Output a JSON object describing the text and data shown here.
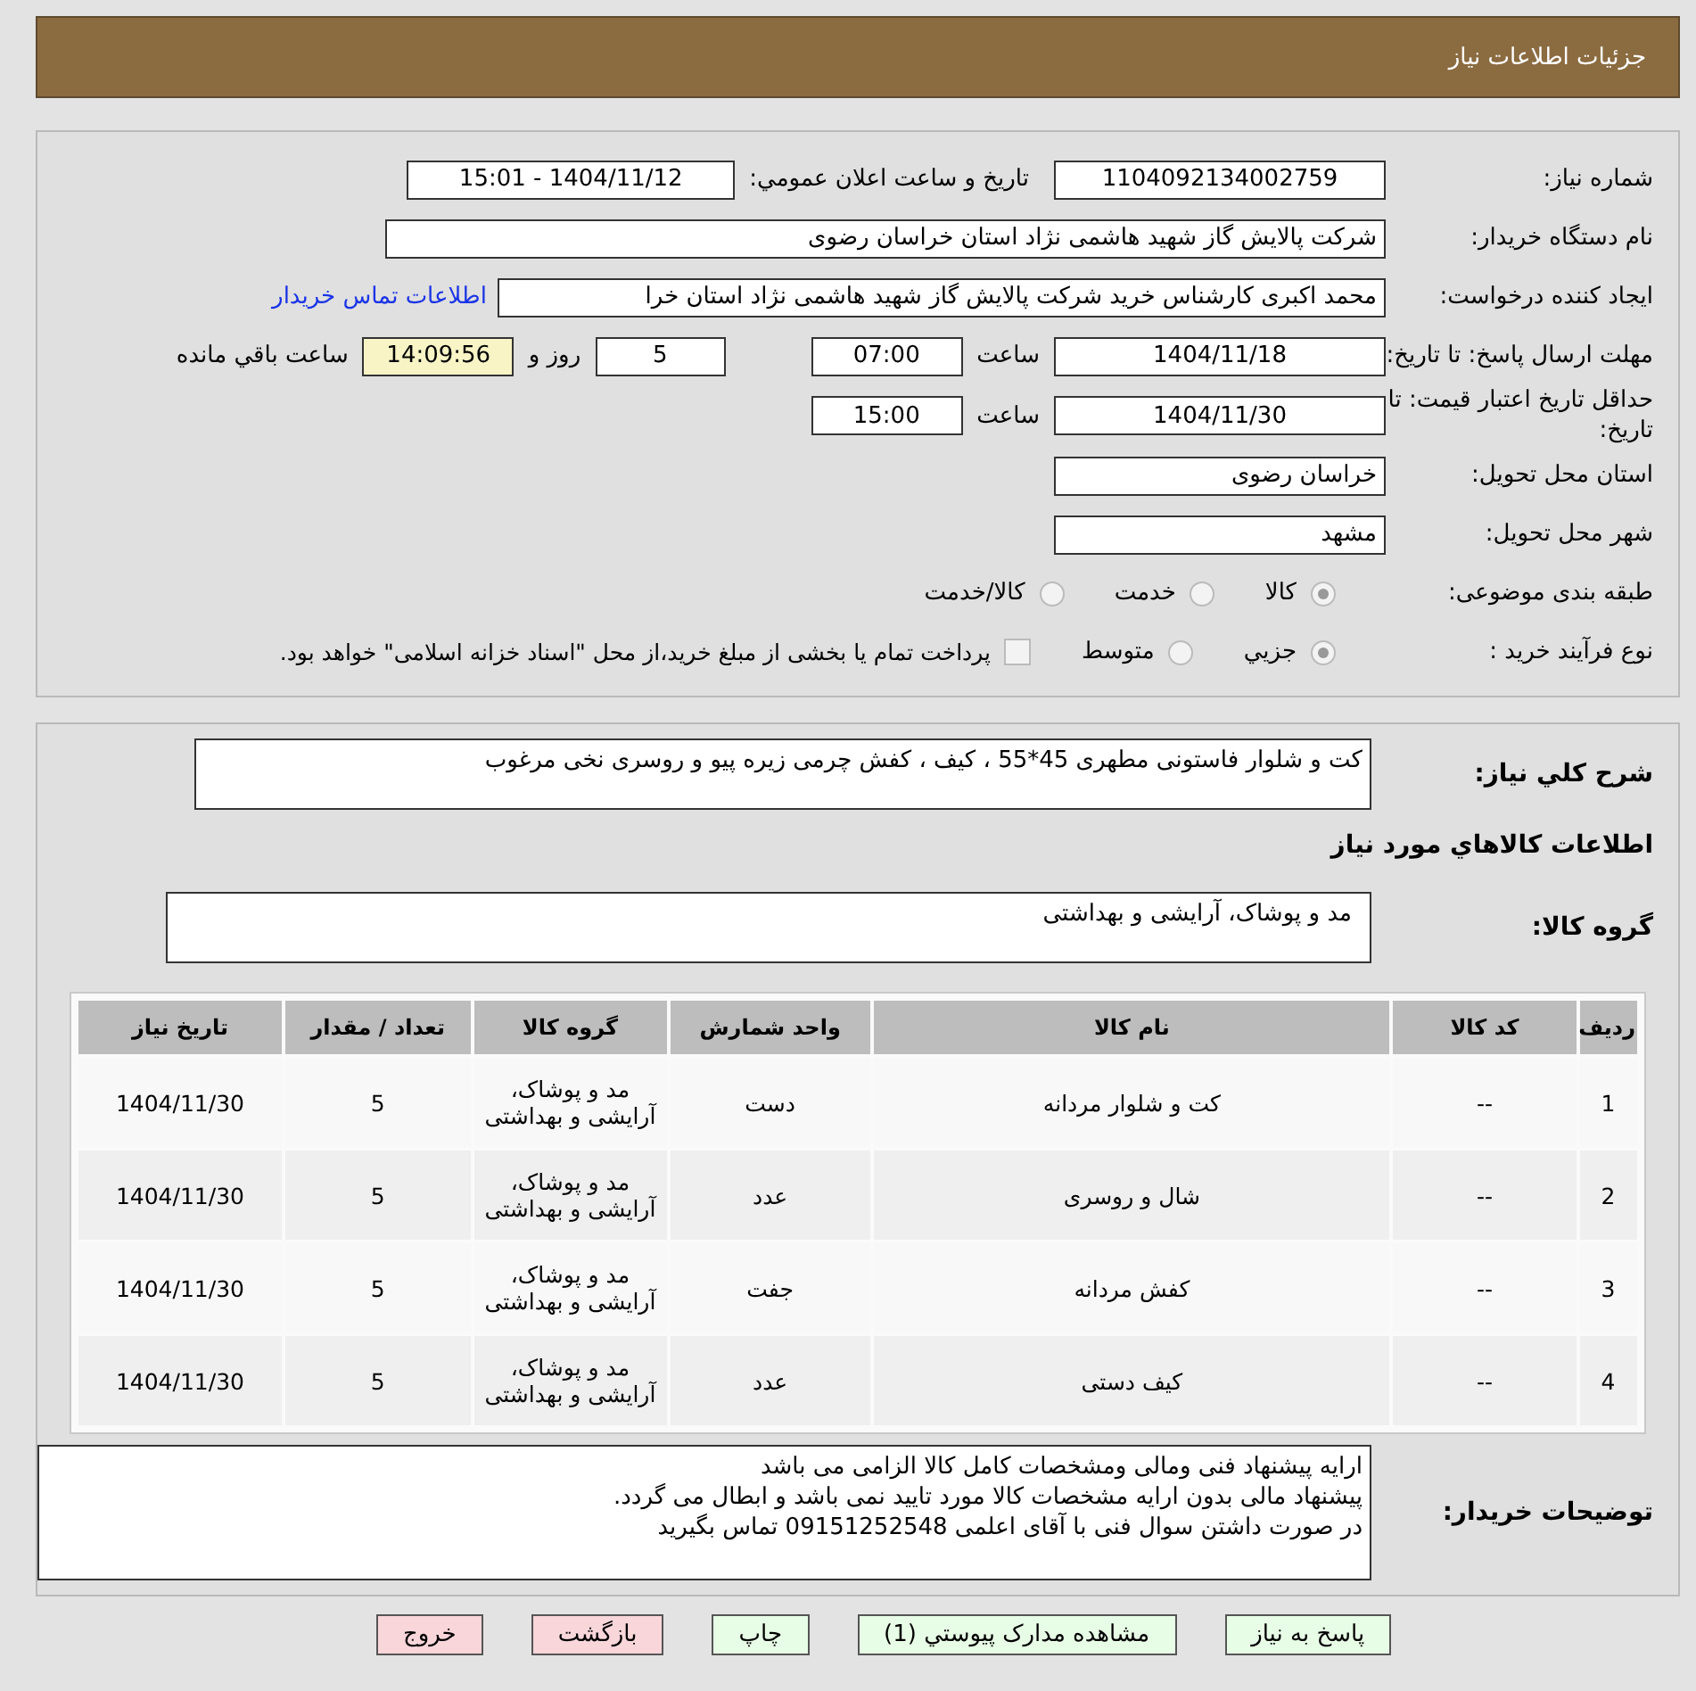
{
  "header": {
    "title": "جزئیات اطلاعات نیاز"
  },
  "form": {
    "need_number": {
      "label": "شماره نیاز:",
      "value": "1104092134002759"
    },
    "announce": {
      "label": "تاریخ و ساعت اعلان عمومي:",
      "value": "1404/11/12 - 15:01"
    },
    "buyer": {
      "label": "نام دستگاه خریدار:",
      "value": "شرکت پالایش گاز شهید هاشمی نژاد   استان خراسان رضوی"
    },
    "requester": {
      "label": "ایجاد کننده درخواست:",
      "value": "محمد اکبری کارشناس خرید شرکت پالایش گاز شهید هاشمی نژاد   استان خرا",
      "link": "اطلاعات تماس خریدار"
    },
    "deadline": {
      "label": "مهلت ارسال پاسخ: تا تاریخ:",
      "date": "1404/11/18",
      "time_label": "ساعت",
      "time": "07:00",
      "days": "5",
      "days_label": "روز و",
      "remaining": "14:09:56",
      "remaining_label": "ساعت باقي مانده"
    },
    "validity": {
      "label": "حداقل تاریخ اعتبار قیمت: تا تاریخ:",
      "date": "1404/11/30",
      "time_label": "ساعت",
      "time": "15:00"
    },
    "province": {
      "label": "استان محل تحویل:",
      "value": "خراسان رضوی"
    },
    "city": {
      "label": "شهر محل تحویل:",
      "value": "مشهد"
    },
    "category": {
      "label": "طبقه بندی موضوعی:",
      "options": [
        {
          "label": "کالا",
          "selected": true
        },
        {
          "label": "خدمت",
          "selected": false
        },
        {
          "label": "کالا/خدمت",
          "selected": false
        }
      ]
    },
    "process": {
      "label": "نوع فرآیند خرید :",
      "options": [
        {
          "label": "جزيي",
          "selected": true
        },
        {
          "label": "متوسط",
          "selected": false
        }
      ],
      "treasury": {
        "label": "پرداخت تمام یا بخشی از مبلغ خرید،از محل \"اسناد خزانه اسلامی\" خواهد بود.",
        "checked": false
      }
    }
  },
  "details": {
    "description": {
      "label": "شرح کلي نياز:",
      "value": "کت و شلوار فاستونی مطهری 45*55 ، کیف ، کفش چرمی زیره پیو و روسری نخی مرغوب"
    },
    "items_title": "اطلاعات کالاهاي مورد نياز",
    "group": {
      "label": "گروه کالا:",
      "value": "مد و پوشاک، آرایشی و بهداشتی"
    },
    "table": {
      "columns": [
        "رديف",
        "کد کالا",
        "نام کالا",
        "واحد شمارش",
        "گروه کالا",
        "تعداد / مقدار",
        "تاریخ نیاز"
      ],
      "rows": [
        [
          "1",
          "--",
          "کت و شلوار مردانه",
          "دست",
          "مد و پوشاک، آرایشی و بهداشتی",
          "5",
          "1404/11/30"
        ],
        [
          "2",
          "--",
          "شال و روسری",
          "عدد",
          "مد و پوشاک، آرایشی و بهداشتی",
          "5",
          "1404/11/30"
        ],
        [
          "3",
          "--",
          "کفش مردانه",
          "جفت",
          "مد و پوشاک، آرایشی و بهداشتی",
          "5",
          "1404/11/30"
        ],
        [
          "4",
          "--",
          "کیف دستی",
          "عدد",
          "مد و پوشاک، آرایشی و بهداشتی",
          "5",
          "1404/11/30"
        ]
      ]
    },
    "notes": {
      "label": "توضیحات خریدار:",
      "lines": [
        "ارایه پیشنهاد فنی ومالی ومشخصات کامل کالا الزامی می باشد",
        "پیشنهاد مالی بدون ارایه مشخصات کالا مورد تایید نمی باشد و ابطال می گردد.",
        " در صورت داشتن سوال فنی با آقای اعلمی 09151252548 تماس بگیرید"
      ]
    }
  },
  "buttons": [
    {
      "label": "پاسخ به نیاز",
      "kind": "action"
    },
    {
      "label": "مشاهده مدارک پیوستي (1)",
      "kind": "action"
    },
    {
      "label": "چاپ",
      "kind": "action"
    },
    {
      "label": "بازگشت",
      "kind": "exit"
    },
    {
      "label": "خروج",
      "kind": "exit"
    }
  ]
}
